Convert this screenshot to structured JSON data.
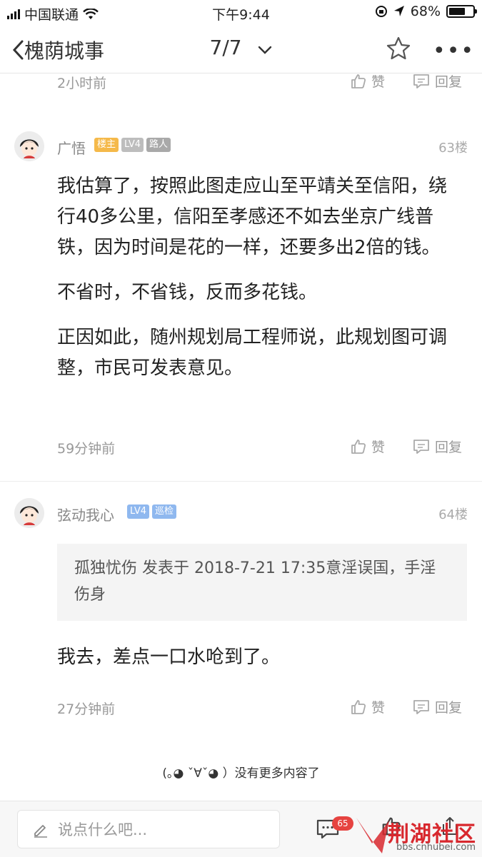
{
  "status_bar": {
    "carrier": "中国联通",
    "time": "下午9:44",
    "battery": "68%",
    "battery_level": 0.68
  },
  "navbar": {
    "back_label": "槐荫城事",
    "page_indicator": "7/7"
  },
  "prev_post": {
    "time": "2小时前",
    "like_label": "赞",
    "reply_label": "回复"
  },
  "posts": [
    {
      "username": "广悟",
      "badges": [
        {
          "text": "楼主",
          "color": "#f5b94a"
        },
        {
          "text": "LV4",
          "color": "#bdbdbd"
        },
        {
          "text": "路人",
          "color": "#a9a9a9"
        }
      ],
      "floor": "63楼",
      "paragraphs": [
        "我估算了，按照此图走应山至平靖关至信阳，绕行40多公里，信阳至孝感还不如去坐京广线普铁，因为时间是花的一样，还要多出2倍的钱。",
        "不省时，不省钱，反而多花钱。",
        "正因如此，随州规划局工程师说，此规划图可调整，市民可发表意见。"
      ],
      "time": "59分钟前",
      "like_label": "赞",
      "reply_label": "回复"
    },
    {
      "username": "弦动我心",
      "badges": [
        {
          "text": "LV4",
          "color": "#8fb8ef"
        },
        {
          "text": "巡检",
          "color": "#8fb8ef"
        }
      ],
      "floor": "64楼",
      "quote": "孤独忧伤 发表于 2018-7-21 17:35意淫误国，手淫伤身",
      "paragraphs": [
        "我去，差点一口水呛到了。"
      ],
      "time": "27分钟前",
      "like_label": "赞",
      "reply_label": "回复"
    }
  ],
  "end_text": "(｡◕ ˇ∀ˇ◕ ）没有更多内容了",
  "bottom_bar": {
    "input_placeholder": "说点什么吧...",
    "comment_count": "65"
  },
  "watermark": {
    "text": "荆湖社区",
    "url": "bbs.cnhubei.com"
  }
}
